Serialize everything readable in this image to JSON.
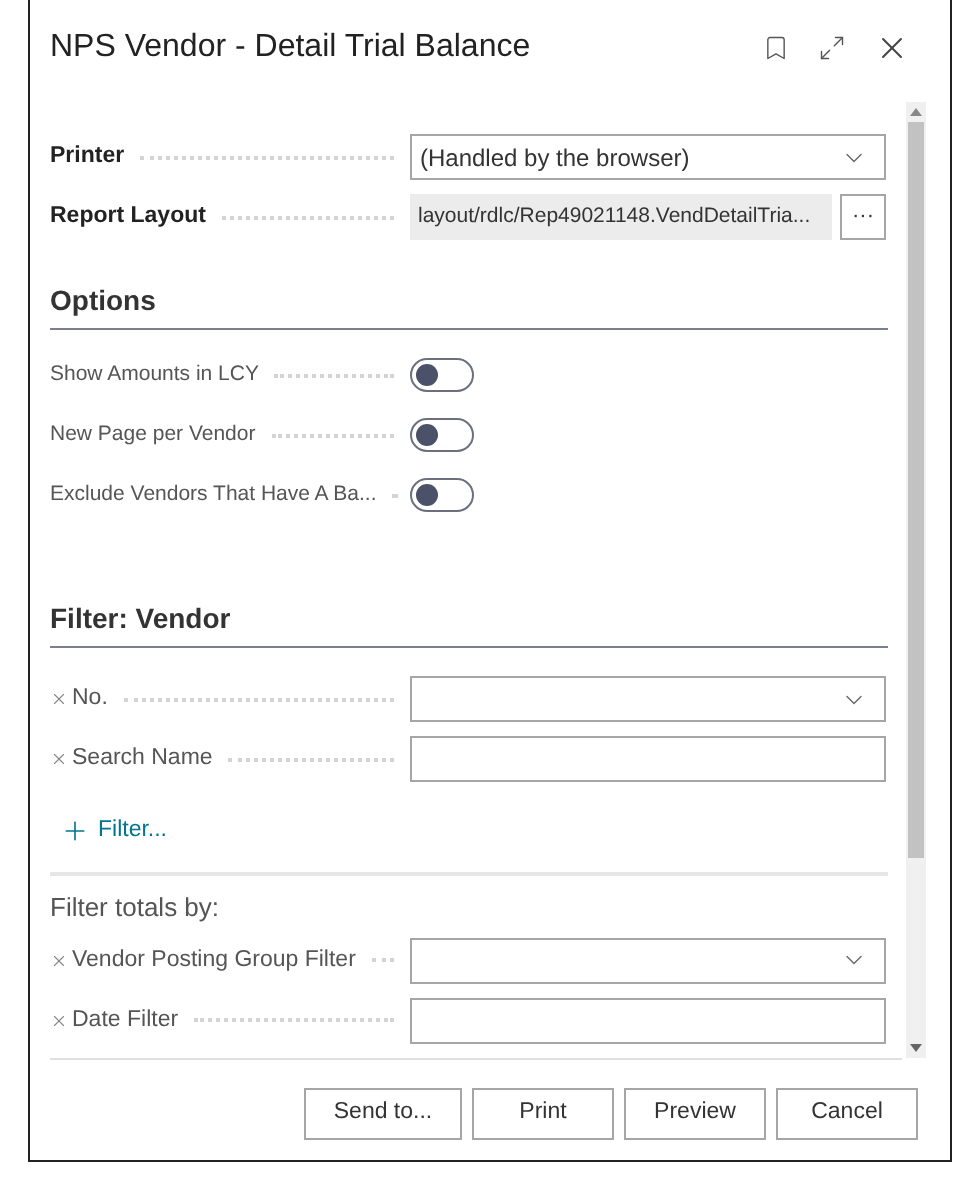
{
  "window": {
    "title": "NPS Vendor - Detail Trial Balance"
  },
  "settings": [
    {
      "label": "Printer",
      "kind": "dropdown",
      "value": "(Handled by the browser)"
    },
    {
      "label": "Report Layout",
      "kind": "readonly",
      "value": "layout/rdlc/Rep49021148.VendDetailTria...",
      "button": "···"
    }
  ],
  "options": {
    "heading": "Options",
    "toggles": [
      {
        "label": "Show Amounts in LCY",
        "on": false
      },
      {
        "label": "New Page per Vendor",
        "on": false
      },
      {
        "label": "Exclude Vendors That Have A Ba...",
        "on": false
      }
    ]
  },
  "filter": {
    "heading": "Filter: Vendor",
    "fields": [
      {
        "label": "No.",
        "kind": "dropdown"
      },
      {
        "label": "Search Name",
        "kind": "text"
      }
    ],
    "add_filter": "Filter..."
  },
  "totals": {
    "heading": "Filter totals by:",
    "fields": [
      {
        "label": "Vendor Posting Group Filter",
        "kind": "dropdown"
      },
      {
        "label": "Date Filter",
        "kind": "text"
      }
    ]
  },
  "buttons": [
    "Send to...",
    "Print",
    "Preview",
    "Cancel"
  ]
}
